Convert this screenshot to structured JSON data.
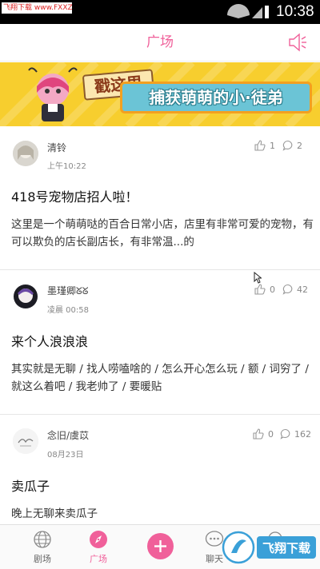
{
  "status_bar": {
    "watermark": "飞翔下载 www.FXXZ.com",
    "time": "10:38"
  },
  "header": {
    "title": "广场"
  },
  "banner": {
    "line1": "戳这里",
    "line2": "捕获萌萌的小·徒弟"
  },
  "posts": [
    {
      "author": "清铃",
      "time": "上午10:22",
      "likes": "1",
      "comments": "2",
      "title": "418号宠物店招人啦！",
      "body": "这里是一个萌萌哒的百合日常小店，店里有非常可爱的宠物，有可以欺负的店长副店长，有非常温...的"
    },
    {
      "author": "墨瑾卿ᘜᘜ",
      "time": "凌晨 00:58",
      "likes": "0",
      "comments": "42",
      "title": "来个人浪浪浪",
      "body": "其实就是无聊 / 找人唠嗑啥的 / 怎么开心怎么玩 / 额 / 词穷了 / 就这么着吧 / 我老帅了 / 要暖贴"
    },
    {
      "author": "念旧/虞苡",
      "time": "08月23日",
      "likes": "0",
      "comments": "162",
      "title": "卖瓜子",
      "body": "晚上无聊来卖瓜子"
    }
  ],
  "bottom_nav": {
    "items": [
      {
        "label": "剧场",
        "icon": "globe-icon"
      },
      {
        "label": "广场",
        "icon": "compass-icon"
      },
      {
        "label": "",
        "icon": "plus-icon"
      },
      {
        "label": "聊天",
        "icon": "chat-bubble-icon"
      },
      {
        "label": "",
        "icon": "search-icon"
      }
    ]
  },
  "watermark_bottom": "飞翔下载",
  "colors": {
    "accent": "#f0609a",
    "banner_bg": "#f7ce2e",
    "banner_strip": "#6bc4d6"
  }
}
